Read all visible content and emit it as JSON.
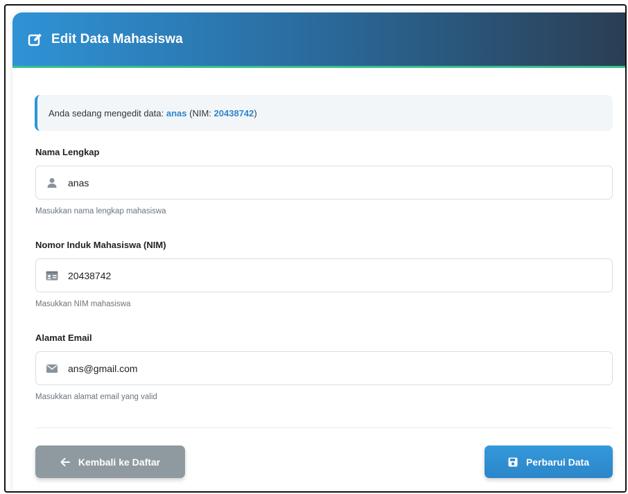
{
  "header": {
    "title": "Edit Data Mahasiswa",
    "icon": "edit-icon"
  },
  "info": {
    "prefix": "Anda sedang mengedit data:",
    "name": "anas",
    "nim_open": "(NIM:",
    "nim": "20438742",
    "nim_close": ")"
  },
  "fields": {
    "nama": {
      "label": "Nama Lengkap",
      "value": "anas",
      "help": "Masukkan nama lengkap mahasiswa",
      "icon": "user-icon"
    },
    "nim": {
      "label": "Nomor Induk Mahasiswa (NIM)",
      "value": "20438742",
      "help": "Masukkan NIM mahasiswa",
      "icon": "id-card-icon"
    },
    "email": {
      "label": "Alamat Email",
      "value": "ans@gmail.com",
      "help": "Masukkan alamat email yang valid",
      "icon": "envelope-icon"
    }
  },
  "actions": {
    "back_label": "Kembali ke Daftar",
    "save_label": "Perbarui Data"
  },
  "colors": {
    "accent": "#2f93d6",
    "header_dark": "#2b3e52",
    "header_border": "#37c08a",
    "back_button": "#8f9aa0",
    "save_button": "#3498db"
  }
}
